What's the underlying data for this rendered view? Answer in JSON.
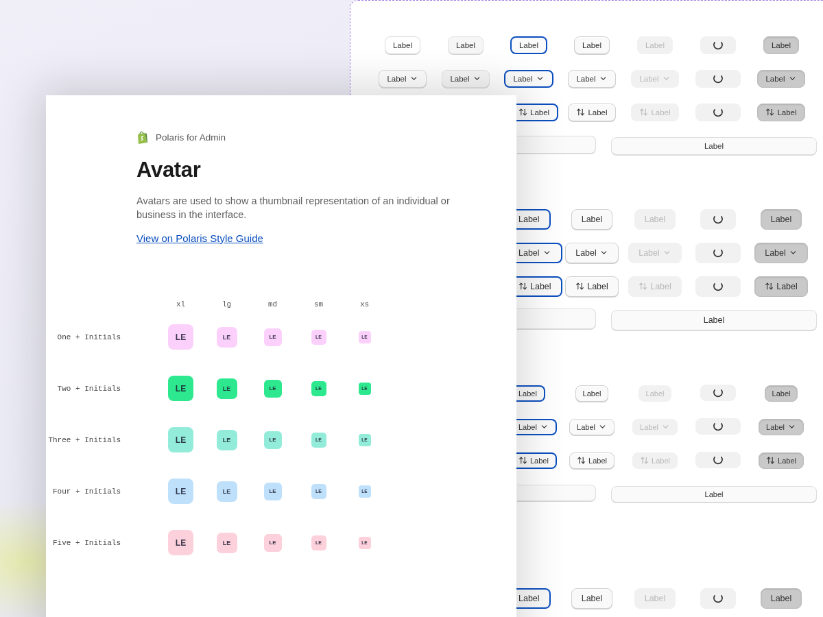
{
  "button_board": {
    "sections": [
      {
        "kind": "medium",
        "rows": [
          {
            "kind": "plain",
            "buttons": [
              {
                "kind": "default",
                "label": "Label"
              },
              {
                "kind": "subtle",
                "label": "Label"
              },
              {
                "kind": "focused",
                "label": "Label"
              },
              {
                "kind": "raised",
                "label": "Label"
              },
              {
                "kind": "disabled",
                "label": "Label"
              },
              {
                "kind": "loading"
              },
              {
                "kind": "pressed",
                "label": "Label"
              }
            ]
          },
          {
            "kind": "dropdown",
            "buttons": [
              {
                "kind": "default",
                "label": "Label"
              },
              {
                "kind": "subtle",
                "label": "Label"
              },
              {
                "kind": "focused",
                "label": "Label"
              },
              {
                "kind": "raised",
                "label": "Label"
              },
              {
                "kind": "disabled",
                "label": "Label"
              },
              {
                "kind": "loading"
              },
              {
                "kind": "pressed",
                "label": "Label"
              }
            ]
          },
          {
            "kind": "sort",
            "buttons": [
              {
                "kind": "focused",
                "label": "Label"
              },
              {
                "kind": "raised",
                "label": "Label"
              },
              {
                "kind": "disabled",
                "label": "Label"
              },
              {
                "kind": "loading"
              },
              {
                "kind": "pressed",
                "label": "Label"
              }
            ]
          }
        ],
        "wide_row": [
          {
            "kind": "blank"
          },
          {
            "kind": "text",
            "label": "Label"
          }
        ]
      },
      {
        "kind": "large",
        "rows": [
          {
            "kind": "plain",
            "buttons": [
              {
                "kind": "focused",
                "label": "Label"
              },
              {
                "kind": "raised",
                "label": "Label"
              },
              {
                "kind": "disabled",
                "label": "Label"
              },
              {
                "kind": "loading"
              },
              {
                "kind": "pressed",
                "label": "Label"
              }
            ]
          },
          {
            "kind": "dropdown",
            "buttons": [
              {
                "kind": "focused",
                "label": "Label"
              },
              {
                "kind": "raised",
                "label": "Label"
              },
              {
                "kind": "disabled",
                "label": "Label"
              },
              {
                "kind": "loading"
              },
              {
                "kind": "pressed",
                "label": "Label"
              }
            ]
          },
          {
            "kind": "sort",
            "buttons": [
              {
                "kind": "focused",
                "label": "Label"
              },
              {
                "kind": "raised",
                "label": "Label"
              },
              {
                "kind": "disabled",
                "label": "Label"
              },
              {
                "kind": "loading"
              },
              {
                "kind": "pressed",
                "label": "Label"
              }
            ]
          }
        ],
        "wide_row": [
          {
            "kind": "blank"
          },
          {
            "kind": "text",
            "label": "Label"
          }
        ]
      },
      {
        "kind": "small",
        "rows": [
          {
            "kind": "plain",
            "buttons": [
              {
                "kind": "focused",
                "label": "Label"
              },
              {
                "kind": "raised",
                "label": "Label"
              },
              {
                "kind": "disabled",
                "label": "Label"
              },
              {
                "kind": "loading"
              },
              {
                "kind": "pressed",
                "label": "Label"
              }
            ]
          },
          {
            "kind": "dropdown",
            "buttons": [
              {
                "kind": "focused",
                "label": "Label"
              },
              {
                "kind": "raised",
                "label": "Label"
              },
              {
                "kind": "disabled",
                "label": "Label"
              },
              {
                "kind": "loading"
              },
              {
                "kind": "pressed",
                "label": "Label"
              }
            ]
          },
          {
            "kind": "sort",
            "buttons": [
              {
                "kind": "focused",
                "label": "Label"
              },
              {
                "kind": "raised",
                "label": "Label"
              },
              {
                "kind": "disabled",
                "label": "Label"
              },
              {
                "kind": "loading"
              },
              {
                "kind": "pressed",
                "label": "Label"
              }
            ]
          }
        ],
        "wide_row": [
          {
            "kind": "blank"
          },
          {
            "kind": "text",
            "label": "Label"
          }
        ]
      },
      {
        "kind": "large",
        "rows": [
          {
            "kind": "plain",
            "buttons": [
              {
                "kind": "focused",
                "label": "Label"
              },
              {
                "kind": "raised",
                "label": "Label"
              },
              {
                "kind": "disabled",
                "label": "Label"
              },
              {
                "kind": "loading"
              },
              {
                "kind": "pressed",
                "label": "Label"
              }
            ]
          }
        ]
      }
    ]
  },
  "doc_card": {
    "brand": "Polaris for Admin",
    "title": "Avatar",
    "description": "Avatars are used to show a thumbnail representation of an individual or business in the interface.",
    "link": "View on Polaris Style Guide",
    "size_columns": [
      "xl",
      "lg",
      "md",
      "sm",
      "xs"
    ],
    "avatar_rows": [
      {
        "label": "One + Initials",
        "color": "#fbd1fb",
        "initials": [
          "LE",
          "LE",
          "LE",
          "LE",
          "LE"
        ]
      },
      {
        "label": "Two + Initials",
        "color": "#2ee88f",
        "initials": [
          "LE",
          "LE",
          "LE",
          "LE",
          "LE"
        ]
      },
      {
        "label": "Three + Initials",
        "color": "#92ecd9",
        "initials": [
          "LE",
          "LE",
          "LE",
          "LE",
          "LE"
        ]
      },
      {
        "label": "Four + Initials",
        "color": "#bfe0fb",
        "initials": [
          "LE",
          "LE",
          "LE",
          "LE",
          "LE"
        ]
      },
      {
        "label": "Five + Initials",
        "color": "#fdd1dc",
        "initials": [
          "LE",
          "LE",
          "LE",
          "LE",
          "LE"
        ]
      }
    ]
  }
}
